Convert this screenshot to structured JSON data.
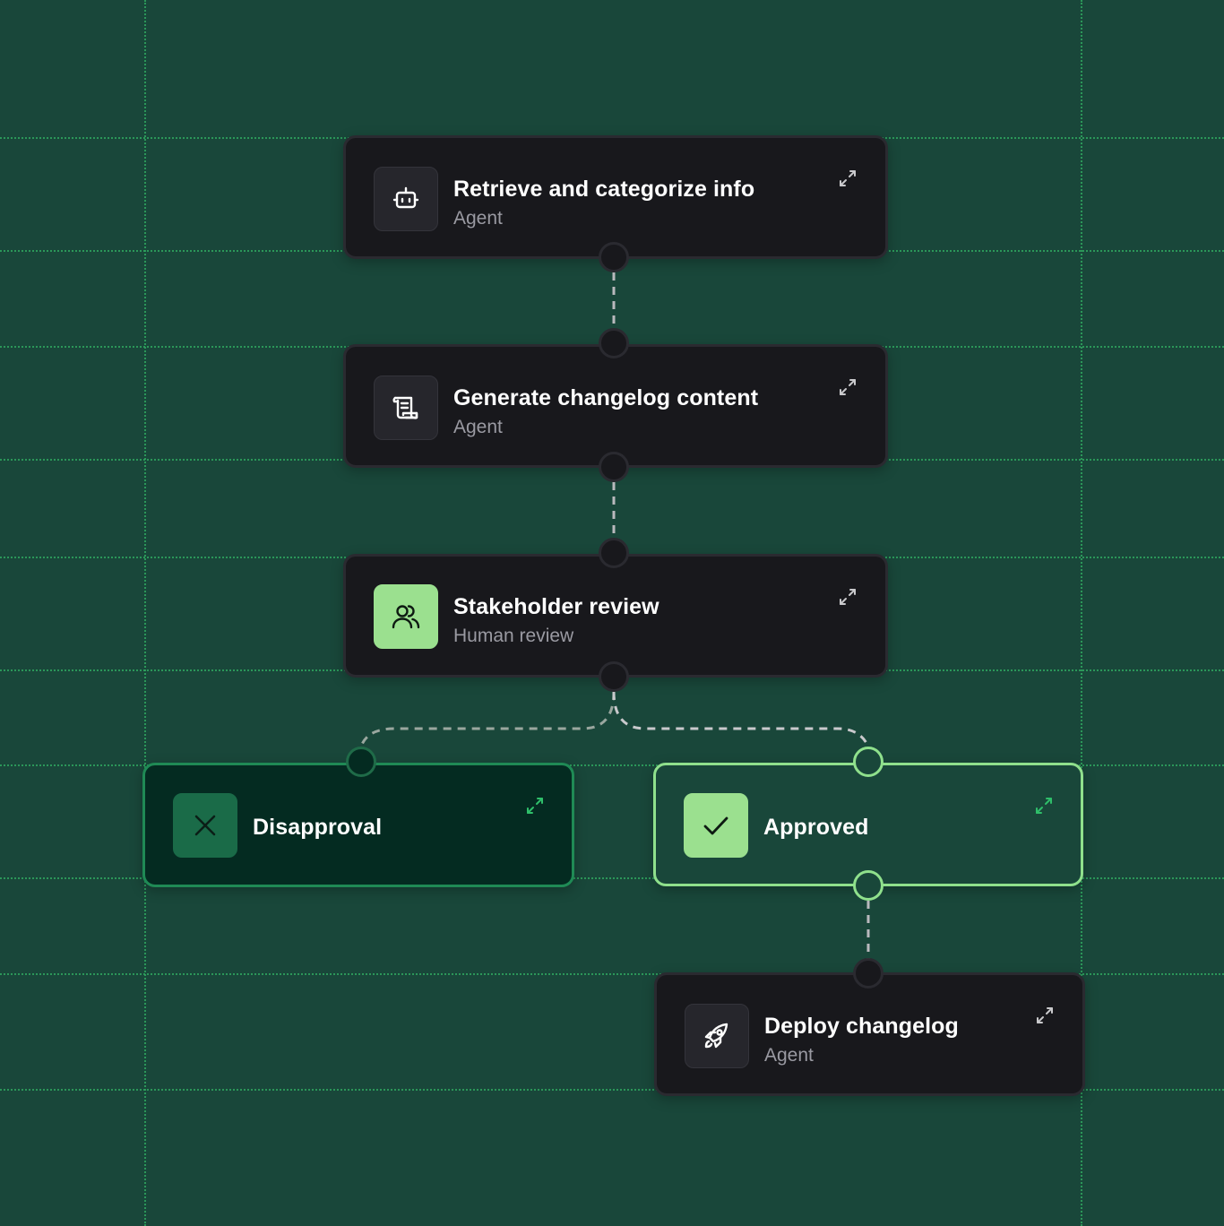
{
  "colors": {
    "background": "#19473a",
    "grid": "#2fa55f",
    "node_dark": "#18181c",
    "accent_green": "#9be08f",
    "disapproval_bg": "#042b21",
    "disapproval_border": "#1f8a55",
    "connector": "#b9b9bd"
  },
  "nodes": {
    "retrieve": {
      "title": "Retrieve and categorize info",
      "subtitle": "Agent",
      "icon": "robot-icon"
    },
    "generate": {
      "title": "Generate changelog content",
      "subtitle": "Agent",
      "icon": "scroll-icon"
    },
    "review": {
      "title": "Stakeholder review",
      "subtitle": "Human review",
      "icon": "users-icon"
    },
    "disapproval": {
      "title": "Disapproval",
      "icon": "x-icon"
    },
    "approved": {
      "title": "Approved",
      "icon": "check-icon"
    },
    "deploy": {
      "title": "Deploy changelog",
      "subtitle": "Agent",
      "icon": "rocket-icon"
    }
  }
}
